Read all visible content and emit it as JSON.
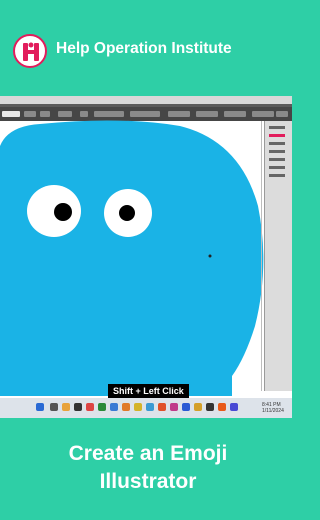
{
  "brand": {
    "name": "Help Operation Institute",
    "logo_color": "#e21c5c",
    "logo_icon": "h-logo-icon"
  },
  "caption": {
    "text": "Shift + Left Click"
  },
  "title": {
    "line1": "Create an Emoji",
    "line2": "Illustrator"
  },
  "colors": {
    "background": "#2ecfa6",
    "emoji_face": "#1ab3e6",
    "eye_white": "#ffffff",
    "pupil": "#000000"
  },
  "taskbar": {
    "time": "8:41 PM",
    "date": "1/11/2024"
  }
}
